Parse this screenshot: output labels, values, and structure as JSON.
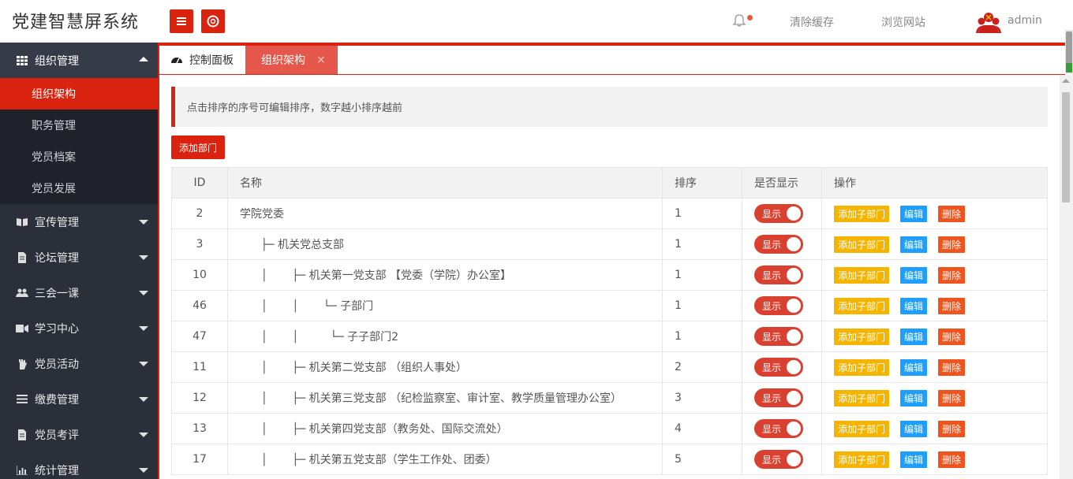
{
  "header": {
    "title": "党建智慧屏系统",
    "clear_cache": "清除缓存",
    "browse_site": "浏览网站",
    "username": "admin"
  },
  "sidebar": {
    "groups": [
      {
        "label": "组织管理",
        "icon": "grid-icon",
        "open": true,
        "items": [
          {
            "label": "组织架构",
            "active": true
          },
          {
            "label": "职务管理"
          },
          {
            "label": "党员档案"
          },
          {
            "label": "党员发展"
          }
        ]
      },
      {
        "label": "宣传管理",
        "icon": "book-icon"
      },
      {
        "label": "论坛管理",
        "icon": "file-icon"
      },
      {
        "label": "三会一课",
        "icon": "users-icon"
      },
      {
        "label": "学习中心",
        "icon": "video-icon"
      },
      {
        "label": "党员活动",
        "icon": "hand-icon"
      },
      {
        "label": "缴费管理",
        "icon": "list-icon"
      },
      {
        "label": "党员考评",
        "icon": "file-icon"
      },
      {
        "label": "统计管理",
        "icon": "bar-chart-icon"
      }
    ]
  },
  "tabs": [
    {
      "label": "控制面板",
      "icon": "dashboard-icon"
    },
    {
      "label": "组织架构",
      "active": true,
      "close": "×"
    }
  ],
  "notice": "点击排序的序号可编辑排序，数字越小排序越前",
  "add_button": "添加部门",
  "table": {
    "headers": {
      "id": "ID",
      "name": "名称",
      "sort": "排序",
      "show": "是否显示",
      "ops": "操作"
    },
    "toggle_label": "显示",
    "ops": {
      "add": "添加子部门",
      "edit": "编辑",
      "del": "删除"
    },
    "rows": [
      {
        "id": "2",
        "name": "学院党委",
        "prefix": "",
        "sort": "1"
      },
      {
        "id": "3",
        "name": "机关党总支部",
        "prefix": "      ├─ ",
        "sort": "1"
      },
      {
        "id": "10",
        "name": "机关第一党支部 【党委（学院）办公室】",
        "prefix": "      │       ├─ ",
        "sort": "1"
      },
      {
        "id": "46",
        "name": "子部门",
        "prefix": "      │       │       └─ ",
        "sort": "1"
      },
      {
        "id": "47",
        "name": "子子部门2",
        "prefix": "      │       │         └─ ",
        "sort": "1"
      },
      {
        "id": "11",
        "name": "机关第二党支部 （组织人事处）",
        "prefix": "      │       ├─ ",
        "sort": "2"
      },
      {
        "id": "12",
        "name": "机关第三党支部 （纪检监察室、审计室、教学质量管理办公室）",
        "prefix": "      │       ├─ ",
        "sort": "3"
      },
      {
        "id": "13",
        "name": "机关第四党支部（教务处、国际交流处）",
        "prefix": "      │       ├─ ",
        "sort": "4"
      },
      {
        "id": "17",
        "name": "机关第五党支部（学生工作处、团委）",
        "prefix": "      │       ├─ ",
        "sort": "5"
      }
    ]
  },
  "colors": {
    "primary": "#d9230f",
    "warn": "#f5b400",
    "info": "#1e9fff",
    "danger": "#f0541e"
  }
}
